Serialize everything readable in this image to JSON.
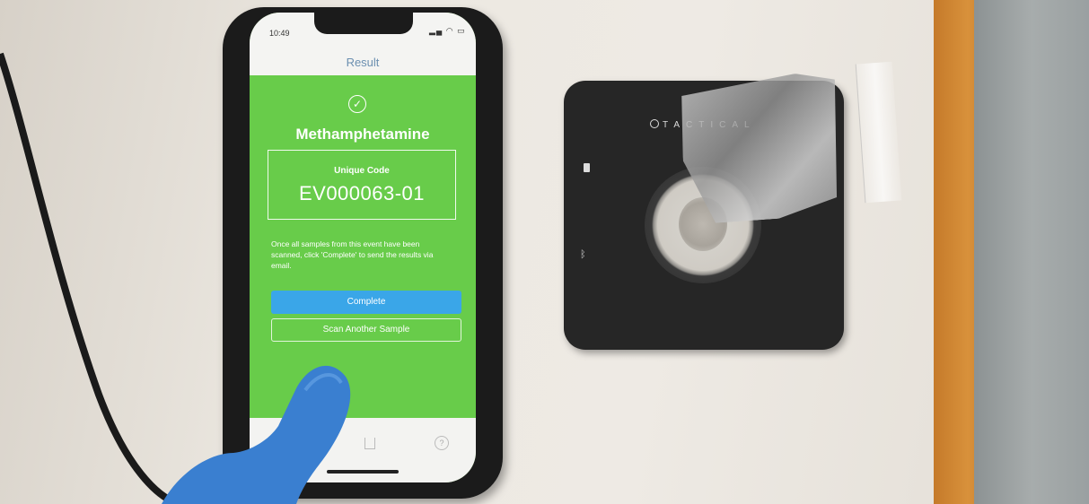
{
  "phone": {
    "status_time": "10:49",
    "nav_title": "Result",
    "substance": "Methamphetamine",
    "code_label": "Unique Code",
    "code_value": "EV000063-01",
    "instructions": "Once all samples from this event have been scanned, click 'Complete' to send the results via email.",
    "complete_button": "Complete",
    "scan_another_button": "Scan Another Sample",
    "help_tab_icon": "question-circle-icon",
    "results_tab_icon": "flask-icon"
  },
  "device": {
    "brand": "TACTICAL"
  },
  "colors": {
    "screen_green": "#68cc4a",
    "complete_blue": "#3aa6e8",
    "nav_title_blue": "#6b8fb0",
    "glove_blue": "#3a7fd0",
    "device_black": "#262626"
  }
}
